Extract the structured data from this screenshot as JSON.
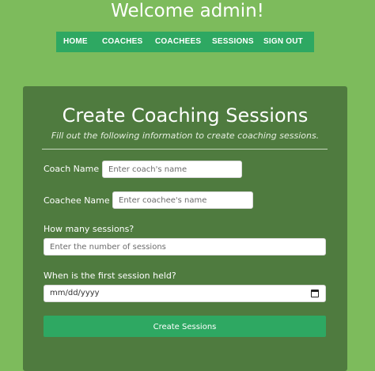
{
  "header": {
    "welcome": "Welcome admin!"
  },
  "nav": {
    "items": [
      "HOME",
      "COACHES",
      "COACHEES",
      "SESSIONS",
      "SIGN OUT"
    ]
  },
  "form": {
    "title": "Create Coaching Sessions",
    "subtitle": "Fill out the following information to create coaching sessions.",
    "coach_label": "Coach Name",
    "coach_placeholder": "Enter coach's name",
    "coachee_label": "Coachee Name",
    "coachee_placeholder": "Enter coachee's name",
    "sessions_label": "How many sessions?",
    "sessions_placeholder": "Enter the number of sessions",
    "date_label": "When is the first session held?",
    "date_value": "mm/dd/yyyy",
    "submit_label": "Create Sessions"
  },
  "colors": {
    "background": "#7dbb5c",
    "card": "#4f7b3f",
    "accent": "#2ea862"
  },
  "icons": {
    "date": "calendar-icon"
  }
}
